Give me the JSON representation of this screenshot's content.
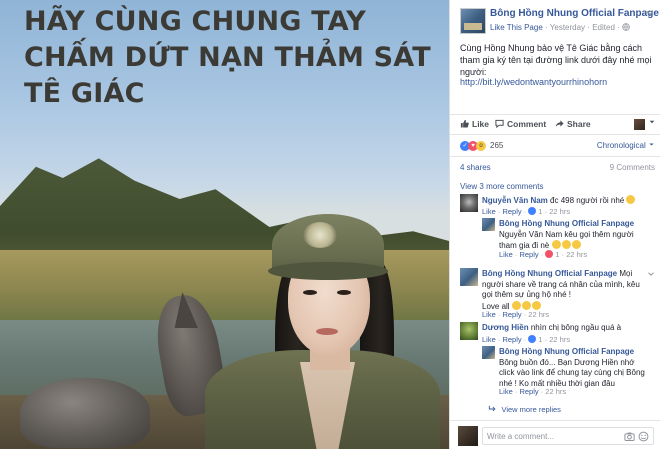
{
  "photo": {
    "title_lines": [
      "HÃY CÙNG  CHUNG TAY",
      "CHẤM DỨT NẠN  THẢM SÁT",
      "TÊ GIÁC"
    ]
  },
  "post": {
    "page_name": "Bông Hồng Nhung Official Fanpage",
    "like_this_page": "Like This Page",
    "time": "Yesterday",
    "edited": "Edited",
    "separator": "·",
    "text": "Cùng Hồng Nhung bảo vệ Tê Giác bằng cách tham gia ký tên tại đường link dưới đây nhé mọi người:",
    "link": "http://bit.ly/wedontwantyourrhinohorn"
  },
  "actions": {
    "like": "Like",
    "comment": "Comment",
    "share": "Share"
  },
  "reactions": {
    "count": "265",
    "order": "Chronological"
  },
  "stats": {
    "shares": "4 shares",
    "comments": "9 Comments"
  },
  "more_comments": "View 3 more comments",
  "comments": [
    {
      "name": "Nguyễn Văn Nam",
      "text": "đc 498 người rồi nhé",
      "like": "Like",
      "reply": "Reply",
      "reacts": "1",
      "time": "22 hrs"
    },
    {
      "name": "Bông Hồng Nhung Official Fanpage",
      "text": "Nguyễn Văn Nam kêu gọi thêm người tham gia đi nè",
      "like": "Like",
      "reply": "Reply",
      "reacts": "1",
      "time": "22 hrs"
    },
    {
      "name": "Bông Hồng Nhung Official Fanpage",
      "text": "Mọi người share về trang cá nhân của mình, kêu gọi thêm sự ủng hộ nhé !",
      "text2": "Love all",
      "like": "Like",
      "reply": "Reply",
      "time": "22 hrs"
    },
    {
      "name": "Dương Hiền",
      "text": "nhìn chị bông ngầu quá à",
      "like": "Like",
      "reply": "Reply",
      "reacts": "1",
      "time": "22 hrs"
    },
    {
      "name": "Bông Hồng Nhung Official Fanpage",
      "text": "Bông buồn đó... Bạn Dương Hiền nhớ click vào link để chung tay cùng chị Bông nhé ! Ko mất nhiều thời gian đâu",
      "like": "Like",
      "reply": "Reply",
      "time": "22 hrs"
    }
  ],
  "more_replies": "View more replies",
  "write_placeholder": "Write a comment...",
  "colors": {
    "link": "#365899",
    "meta": "#90949c",
    "text": "#1d2129",
    "like_blue": "#4080ff",
    "love_red": "#f25268",
    "wow_yellow": "#f7c843"
  }
}
